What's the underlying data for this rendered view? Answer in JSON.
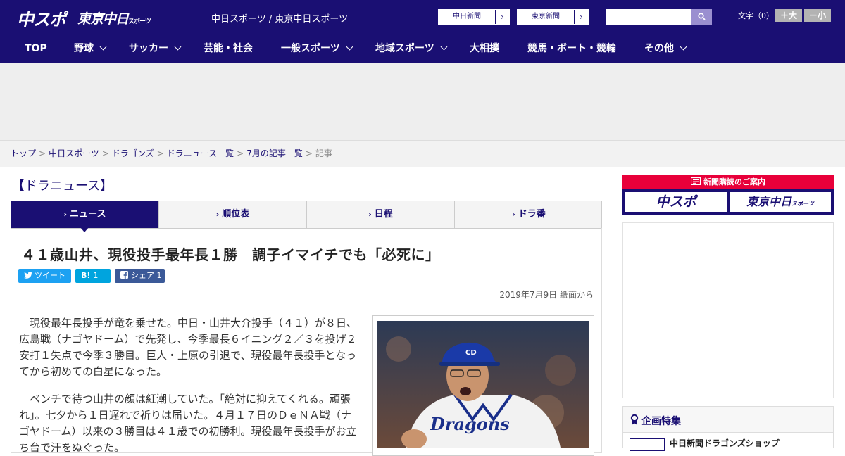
{
  "header": {
    "logo_chuspo": "中スポ",
    "logo_tokyo": "東京中日",
    "logo_tokyo_sub": "スポーツ",
    "site_title": "中日スポーツ / 東京中日スポーツ",
    "ext_links": [
      {
        "label": "中日新聞",
        "arrow": "›"
      },
      {
        "label": "東京新聞",
        "arrow": "›"
      }
    ],
    "search_placeholder": "",
    "font_size_label": "文字（0）",
    "font_plus_label": "＋大",
    "font_minus_label": "－小"
  },
  "nav": {
    "items": [
      {
        "label": "TOP"
      },
      {
        "label": "野球"
      },
      {
        "label": "サッカー"
      },
      {
        "label": "芸能・社会"
      },
      {
        "label": "一般スポーツ"
      },
      {
        "label": "地域スポーツ"
      },
      {
        "label": "大相撲"
      },
      {
        "label": "競馬・ボート・競輪"
      },
      {
        "label": "その他"
      }
    ]
  },
  "breadcrumb": {
    "items": [
      "トップ",
      "中日スポーツ",
      "ドラゴンズ",
      "ドラニュース一覧",
      "7月の記事一覧"
    ],
    "current": "記事",
    "separator": ">"
  },
  "section": {
    "title": "【ドラニュース】"
  },
  "tabs": [
    {
      "label": "ニュース",
      "marker": "›"
    },
    {
      "label": "順位表",
      "marker": "›"
    },
    {
      "label": "日程",
      "marker": "›"
    },
    {
      "label": "ドラ番",
      "marker": "›"
    }
  ],
  "article": {
    "headline": "４１歳山井、現役投手最年長１勝　調子イマイチでも「必死に」",
    "share": {
      "tweet_label": "ツイート",
      "hatena_label": "B!",
      "hatena_count": "1",
      "fb_label": "シェア",
      "fb_count": "1"
    },
    "dateline": "2019年7月9日 紙面から",
    "paragraphs": [
      "　現役最年長投手が竜を乗せた。中日・山井大介投手（４１）が８日、広島戦（ナゴヤドーム）で先発し、今季最長６イニング２／３を投げ２安打１失点で今季３勝目。巨人・上原の引退で、現役最年長投手となってから初めての白星になった。",
      "　ベンチで待つ山井の顔は紅潮していた。「絶対に抑えてくれる。頑張れ」。七夕から１日遅れで祈りは届いた。４月１７日のＤｅＮＡ戦（ナゴヤドーム）以来の３勝目は４１歳での初勝利。現役最年長投手がお立ち台で汗をぬぐった。"
    ],
    "photo_jersey_text": "Dragons"
  },
  "sidebar": {
    "banner_title": "新聞購読のご案内",
    "banner_left": "中スポ",
    "banner_right": "東京中日",
    "banner_right_sub": "スポーツ",
    "feature_title": "企画特集",
    "feature_item": "中日新聞ドラゴンズショップ"
  },
  "colors": {
    "brand_navy": "#1a0f73",
    "banner_red": "#e8003a",
    "twitter": "#1da1f2",
    "hatena": "#00a4de",
    "facebook": "#3b5998"
  }
}
